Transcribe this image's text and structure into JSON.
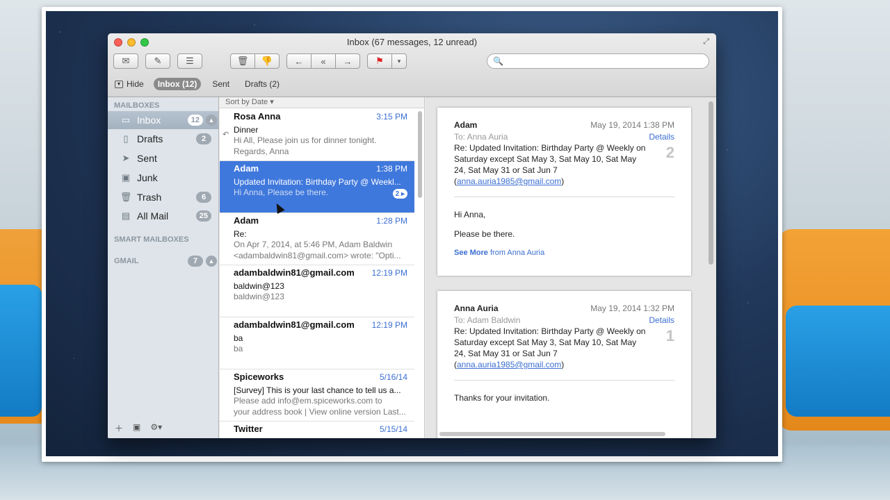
{
  "window": {
    "title": "Inbox (67 messages, 12 unread)"
  },
  "toolbar": {
    "icons": [
      "envelope-icon",
      "compose-icon",
      "note-icon",
      "trash-icon",
      "thumbs-down-icon",
      "reply-icon",
      "reply-all-icon",
      "forward-icon",
      "flag-icon"
    ],
    "search_placeholder": ""
  },
  "favorites": {
    "hide_label": "Hide",
    "inbox_label": "Inbox (12)",
    "sent_label": "Sent",
    "drafts_label": "Drafts (2)"
  },
  "sidebar": {
    "mailboxes_header": "MAILBOXES",
    "items": [
      {
        "label": "Inbox",
        "badge": "12",
        "icon": "inbox-icon"
      },
      {
        "label": "Drafts",
        "badge": "2",
        "icon": "drafts-icon"
      },
      {
        "label": "Sent",
        "badge": "",
        "icon": "sent-icon"
      },
      {
        "label": "Junk",
        "badge": "",
        "icon": "junk-icon"
      },
      {
        "label": "Trash",
        "badge": "6",
        "icon": "trash-icon"
      },
      {
        "label": "All Mail",
        "badge": "25",
        "icon": "all-mail-icon"
      }
    ],
    "smart_header": "SMART MAILBOXES",
    "gmail_header": "GMAIL",
    "gmail_badge": "7"
  },
  "list": {
    "sort_label": "Sort by Date ▾",
    "messages": [
      {
        "from": "Rosa Anna",
        "time": "3:15 PM",
        "subject": "Dinner",
        "preview1": "Hi All, Please join us for dinner tonight.",
        "preview2": "Regards, Anna"
      },
      {
        "from": "Adam",
        "time": "1:38 PM",
        "subject": "Updated Invitation: Birthday Party @ Weekl...",
        "preview1": "Hi Anna, Please be there.",
        "preview2": "",
        "thread": "2 ▸"
      },
      {
        "from": "Adam",
        "time": "1:28 PM",
        "subject": "Re:",
        "preview1": "On Apr 7, 2014, at 5:46 PM, Adam Baldwin",
        "preview2": "<adambaldwin81@gmail.com> wrote: \"Opti..."
      },
      {
        "from": "adambaldwin81@gmail.com",
        "time": "12:19 PM",
        "subject": "baldwin@123",
        "preview1": "baldwin@123",
        "preview2": ""
      },
      {
        "from": "adambaldwin81@gmail.com",
        "time": "12:19 PM",
        "subject": "ba",
        "preview1": "ba",
        "preview2": ""
      },
      {
        "from": "Spiceworks",
        "time": "5/16/14",
        "subject": "[Survey] This is your last chance to tell us a...",
        "preview1": "Please add info@em.spiceworks.com to",
        "preview2": "your address book | View online version Last..."
      },
      {
        "from": "Twitter",
        "time": "5/15/14",
        "subject": "",
        "preview1": "",
        "preview2": ""
      }
    ]
  },
  "reader": {
    "cards": [
      {
        "from": "Adam",
        "date": "May 19, 2014  1:38 PM",
        "to": "To: Anna Auria",
        "details": "Details",
        "num": "2",
        "subject": "Re: Updated Invitation: Birthday Party @ Weekly on Saturday except Sat May 3, Sat May 10, Sat May 24, Sat May 31 or Sat Jun 7",
        "email": "anna.auria1985@gmail.com",
        "body1": "Hi Anna,",
        "body2": "Please be there.",
        "see_more": "See More",
        "see_more_from": " from Anna Auria"
      },
      {
        "from": "Anna Auria",
        "date": "May 19, 2014  1:32 PM",
        "to": "To: Adam Baldwin",
        "details": "Details",
        "num": "1",
        "subject": "Re: Updated Invitation: Birthday Party @ Weekly on Saturday except Sat May 3, Sat May 10, Sat May 24, Sat May 31 or Sat Jun 7",
        "email": "anna.auria1985@gmail.com",
        "body1": "Thanks for your invitation."
      }
    ]
  }
}
